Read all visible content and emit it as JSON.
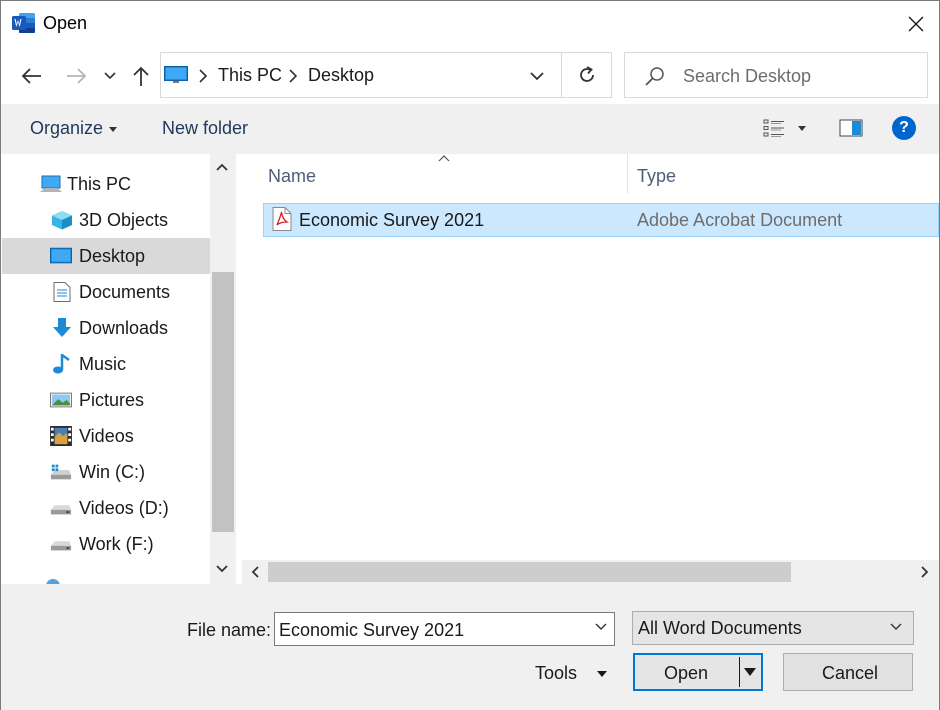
{
  "window": {
    "title": "Open",
    "app_icon": "word-icon",
    "accent": "#0078d7"
  },
  "address": {
    "breadcrumbs": [
      "This PC",
      "Desktop"
    ],
    "search_placeholder": "Search Desktop"
  },
  "toolbar": {
    "organize_label": "Organize",
    "new_folder_label": "New folder"
  },
  "nav": {
    "items": [
      {
        "label": "This PC",
        "icon": "computer-icon"
      },
      {
        "label": "3D Objects",
        "icon": "cube-icon"
      },
      {
        "label": "Desktop",
        "icon": "desktop-icon",
        "selected": true
      },
      {
        "label": "Documents",
        "icon": "document-icon"
      },
      {
        "label": "Downloads",
        "icon": "download-arrow-icon"
      },
      {
        "label": "Music",
        "icon": "music-note-icon"
      },
      {
        "label": "Pictures",
        "icon": "picture-icon"
      },
      {
        "label": "Videos",
        "icon": "film-icon"
      },
      {
        "label": "Win (C:)",
        "icon": "system-drive-icon"
      },
      {
        "label": "Videos (D:)",
        "icon": "drive-icon"
      },
      {
        "label": "Work (F:)",
        "icon": "drive-icon"
      }
    ]
  },
  "file_list": {
    "columns": [
      "Name",
      "Type"
    ],
    "rows": [
      {
        "name": "Economic Survey 2021",
        "type": "Adobe Acrobat Document",
        "icon": "pdf-icon",
        "selected": true
      }
    ]
  },
  "footer": {
    "file_name_label": "File name:",
    "file_name_value": "Economic Survey 2021",
    "file_type_value": "All Word Documents",
    "tools_label": "Tools",
    "open_label": "Open",
    "cancel_label": "Cancel"
  }
}
